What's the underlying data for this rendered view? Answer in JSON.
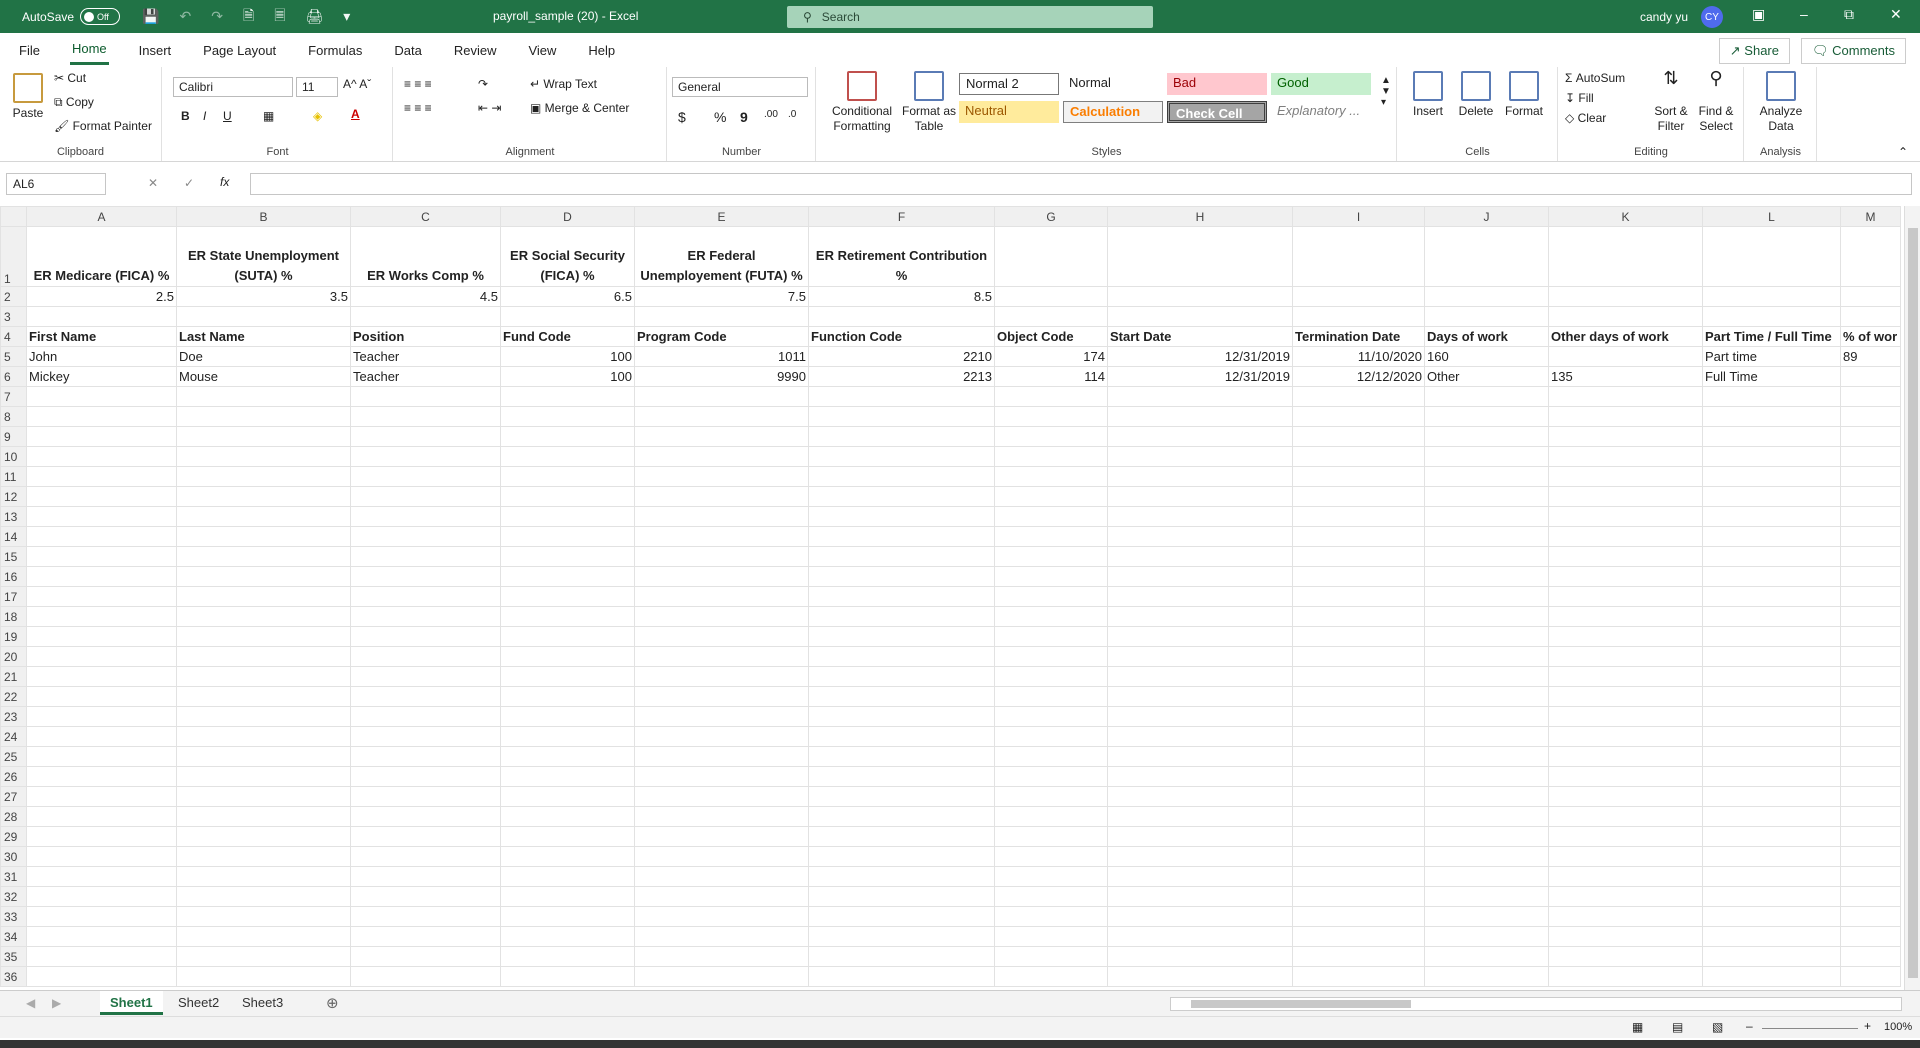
{
  "titlebar": {
    "autosave_label": "AutoSave",
    "autosave_state": "Off",
    "doc_title": "payroll_sample (20)  -  Excel",
    "search_placeholder": "Search",
    "user_name": "candy yu",
    "user_initials": "CY"
  },
  "menu": {
    "tabs": [
      "File",
      "Home",
      "Insert",
      "Page Layout",
      "Formulas",
      "Data",
      "Review",
      "View",
      "Help"
    ],
    "share": "Share",
    "comments": "Comments"
  },
  "ribbon": {
    "clipboard": {
      "label": "Clipboard",
      "paste": "Paste",
      "cut": "Cut",
      "copy": "Copy",
      "format_painter": "Format Painter"
    },
    "font": {
      "label": "Font",
      "name": "Calibri",
      "size": "11"
    },
    "alignment": {
      "label": "Alignment",
      "wrap_text": "Wrap Text",
      "merge_center": "Merge & Center"
    },
    "number": {
      "label": "Number",
      "format": "General"
    },
    "styles": {
      "label": "Styles",
      "conditional": "Conditional Formatting",
      "format_table": "Format as Table",
      "cells": [
        "Normal 2",
        "Normal",
        "Bad",
        "Good",
        "Neutral",
        "Calculation",
        "Check Cell",
        "Explanatory ..."
      ]
    },
    "cells": {
      "label": "Cells",
      "insert": "Insert",
      "delete": "Delete",
      "format": "Format"
    },
    "editing": {
      "label": "Editing",
      "autosum": "AutoSum",
      "fill": "Fill",
      "clear": "Clear",
      "sort_filter": "Sort & Filter",
      "find_select": "Find & Select"
    },
    "analysis": {
      "label": "Analysis",
      "analyze": "Analyze Data"
    }
  },
  "formula_bar": {
    "name_box": "AL6",
    "formula": ""
  },
  "sheet": {
    "columns": [
      "A",
      "B",
      "C",
      "D",
      "E",
      "F",
      "G",
      "H",
      "I",
      "J",
      "K",
      "L",
      "M"
    ],
    "row1": [
      "ER Medicare (FICA) %",
      "ER State Unemployment (SUTA) %",
      "ER Works Comp %",
      "ER Social Security (FICA) %",
      "ER Federal Unemployement (FUTA) %",
      "ER Retirement Contribution %"
    ],
    "row2": [
      "2.5",
      "3.5",
      "4.5",
      "6.5",
      "7.5",
      "8.5"
    ],
    "row4": [
      "First Name",
      "Last Name",
      "Position",
      "Fund Code",
      "Program Code",
      "Function Code",
      "Object Code",
      "Start Date",
      "Termination Date",
      "Days of work",
      "Other days of work",
      "Part Time / Full Time",
      "% of wor"
    ],
    "row5": [
      "John",
      "Doe",
      "Teacher",
      "100",
      "1011",
      "2210",
      "174",
      "12/31/2019",
      "11/10/2020",
      "160",
      "",
      "Part time",
      "89"
    ],
    "row6": [
      "Mickey",
      "Mouse",
      "Teacher",
      "100",
      "9990",
      "2213",
      "114",
      "12/31/2019",
      "12/12/2020",
      "Other",
      "135",
      "Full Time",
      ""
    ]
  },
  "sheet_tabs": [
    "Sheet1",
    "Sheet2",
    "Sheet3"
  ],
  "status": {
    "zoom": "100%"
  }
}
